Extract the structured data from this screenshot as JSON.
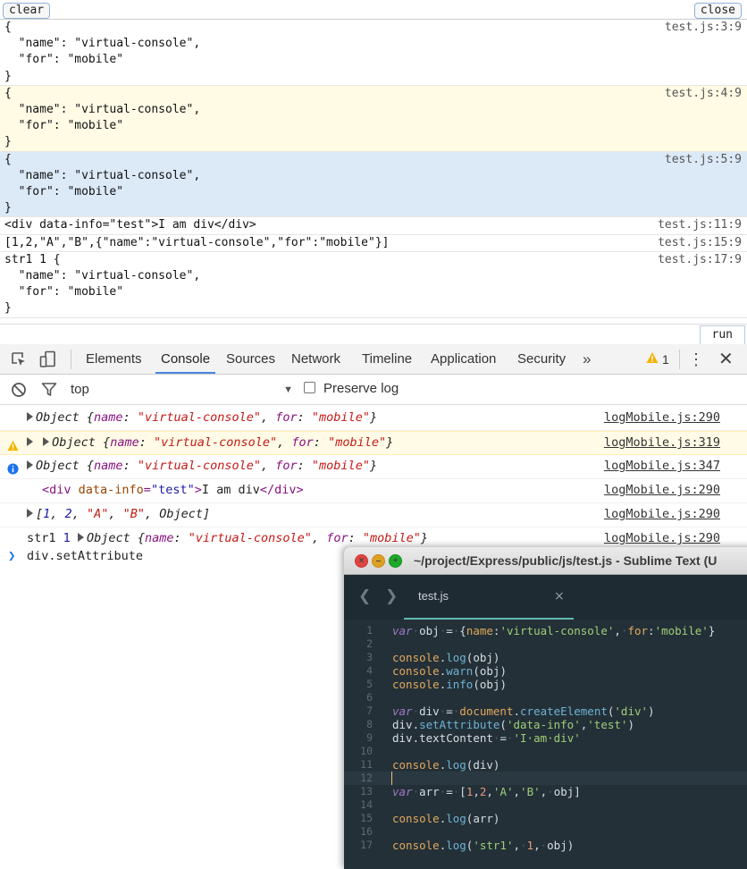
{
  "vconsole": {
    "clear_label": "clear",
    "close_label": "close",
    "run_label": "run",
    "logs": [
      {
        "type": "log",
        "lines": [
          "{",
          "  \"name\": \"virtual-console\",",
          "  \"for\": \"mobile\"",
          "}"
        ],
        "source": "test.js:3:9"
      },
      {
        "type": "warn",
        "lines": [
          "{",
          "  \"name\": \"virtual-console\",",
          "  \"for\": \"mobile\"",
          "}"
        ],
        "source": "test.js:4:9"
      },
      {
        "type": "info",
        "lines": [
          "{",
          "  \"name\": \"virtual-console\",",
          "  \"for\": \"mobile\"",
          "}"
        ],
        "source": "test.js:5:9"
      },
      {
        "type": "log",
        "lines": [
          "<div data-info=\"test\">I am div</div>"
        ],
        "source": "test.js:11:9"
      },
      {
        "type": "log",
        "lines": [
          "[1,2,\"A\",\"B\",{\"name\":\"virtual-console\",\"for\":\"mobile\"}]"
        ],
        "source": "test.js:15:9"
      },
      {
        "type": "log",
        "lines": [
          "str1 1 {",
          "  \"name\": \"virtual-console\",",
          "  \"for\": \"mobile\"",
          "}"
        ],
        "source": "test.js:17:9"
      }
    ]
  },
  "devtools": {
    "tabs": [
      "Elements",
      "Console",
      "Sources",
      "Network",
      "Timeline",
      "Application",
      "Security"
    ],
    "active_tab": "Console",
    "more_label": "»",
    "warning_count": "1",
    "context": "top",
    "preserve_log_label": "Preserve log",
    "messages": {
      "obj_prefix": "Object",
      "name_key": "name",
      "for_key": "for",
      "name_val": "\"virtual-console\"",
      "for_val": "\"mobile\"",
      "src1": "logMobile.js:290",
      "src2": "logMobile.js:319",
      "src3": "logMobile.js:347",
      "src4": "logMobile.js:290",
      "src5": "logMobile.js:290",
      "src6": "logMobile.js:290",
      "div_attr": "data-info",
      "div_attr_val": "\"test\"",
      "div_text": "I am div",
      "arr_n1": "1",
      "arr_n2": "2",
      "arr_s1": "\"A\"",
      "arr_s2": "\"B\"",
      "arr_obj": "Object",
      "str1": "str1",
      "num1": "1"
    },
    "prompt_text": "div.setAttribute"
  },
  "sublime": {
    "title": "~/project/Express/public/js/test.js - Sublime Text (U",
    "tab_name": "test.js",
    "code": {
      "l1_var": "var",
      "l1_obj": "obj",
      "l1_ws1": "·",
      "l1_eq": "=",
      "l1_name": "name",
      "l1_nameval": "'virtual-console'",
      "l1_for": "for",
      "l1_forval": "'mobile'",
      "console": "console",
      "log": "log",
      "warn": "warn",
      "info": "info",
      "obj": "obj",
      "div": "div",
      "document": "document",
      "createElement": "createElement",
      "div_str": "'div'",
      "setAttribute": "setAttribute",
      "data_info_str": "'data-info'",
      "test_str": "'test'",
      "textContent": "textContent",
      "i_am_div_str": "'I·am·div'",
      "arr": "arr",
      "n1": "1",
      "n2": "2",
      "a_str": "'A'",
      "b_str": "'B'",
      "str1_str": "'str1'"
    }
  }
}
